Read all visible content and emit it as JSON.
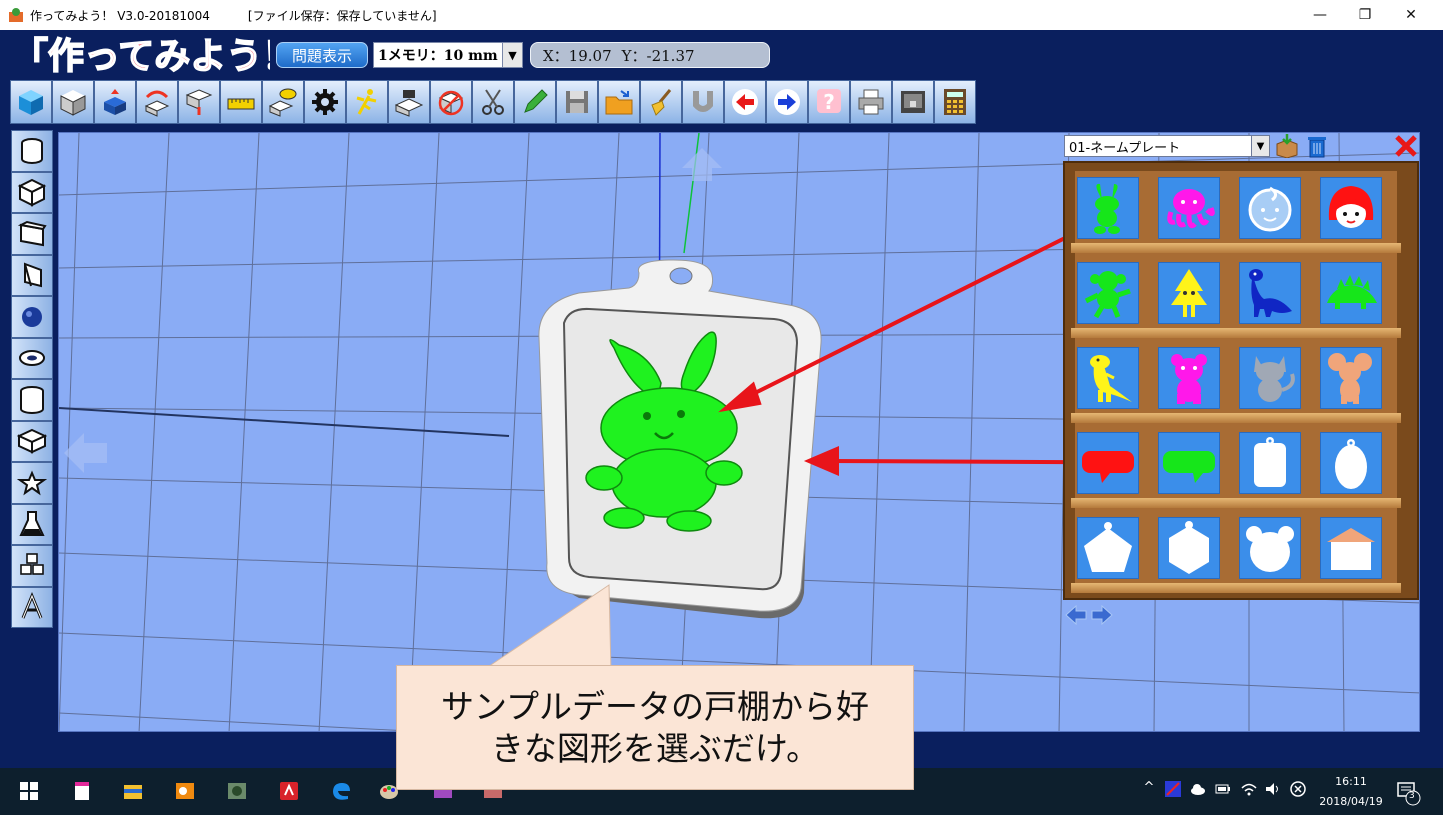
{
  "window": {
    "title": "作ってみよう！ V3.0-20181004",
    "file_status": "[ファイル保存：保存していません]",
    "minimize_glyph": "—",
    "maximize_glyph": "❐",
    "close_glyph": "✕"
  },
  "header": {
    "logo_text": "「作ってみよう！」",
    "problem_button": "問題表示",
    "memo_select_value": "1メモリ：10 mm",
    "coords": {
      "x": "X：19.07",
      "y": "Y：-21.37"
    }
  },
  "toolbar": {
    "tools": [
      "cube-icon",
      "box-icon",
      "move-icon",
      "rotate-icon",
      "drop-icon",
      "ruler-icon",
      "comment-icon",
      "gear-icon",
      "runner-icon",
      "stamp-icon",
      "no-box-icon",
      "scissors-icon",
      "pencil-icon",
      "save-icon",
      "open-folder-icon",
      "broom-icon",
      "magnet-icon",
      "undo-arrow-icon",
      "redo-arrow-icon",
      "help-icon",
      "print-icon",
      "printer3d-icon",
      "calculator-icon"
    ]
  },
  "left_tools": [
    "cylinder-icon",
    "cube-icon",
    "slanted-box-icon",
    "wedge-icon",
    "sphere-icon",
    "ring-icon",
    "tall-cylinder-icon",
    "chamfer-box-icon",
    "star-icon",
    "flask-icon",
    "cubes-icon",
    "letter-a-icon"
  ],
  "shelf": {
    "category": "01-ネームプレート",
    "close_glyph": "✕",
    "items": [
      {
        "name": "rabbit",
        "color": "#16e61a"
      },
      {
        "name": "octopus",
        "color": "#ff18ea"
      },
      {
        "name": "boy-face",
        "color": "#a8cdf5"
      },
      {
        "name": "red-hood",
        "color": "#ff1212"
      },
      {
        "name": "monkey",
        "color": "#16e61a"
      },
      {
        "name": "tree-creature",
        "color": "#fff41a"
      },
      {
        "name": "dinosaur",
        "color": "#1026c4"
      },
      {
        "name": "stegosaurus",
        "color": "#16e61a"
      },
      {
        "name": "t-rex",
        "color": "#fff41a"
      },
      {
        "name": "bear",
        "color": "#ff18ea"
      },
      {
        "name": "cat",
        "color": "#a0a8b5"
      },
      {
        "name": "mouse",
        "color": "#f0a57a"
      },
      {
        "name": "red-speech-bubble",
        "color": "#ff1212"
      },
      {
        "name": "green-speech-bubble",
        "color": "#16e61a"
      },
      {
        "name": "rect-tag",
        "color": "#ffffff"
      },
      {
        "name": "oval-tag",
        "color": "#ffffff"
      },
      {
        "name": "pentagon-tag",
        "color": "#ffffff"
      },
      {
        "name": "hexagon-tag",
        "color": "#ffffff"
      },
      {
        "name": "bear-face-tag",
        "color": "#ffffff"
      },
      {
        "name": "house-tag",
        "color": "#ffffff"
      }
    ]
  },
  "callout": {
    "line1": "サンプルデータの戸棚から好",
    "line2": "きな図形を選ぶだけ。"
  },
  "taskbar": {
    "time": "16:11",
    "date": "2018/04/19",
    "notification_count": "3",
    "apps": [
      "windows-start-icon",
      "notepad-icon",
      "file-explorer-icon",
      "outlook-icon",
      "gaming-app-icon",
      "acrobat-icon",
      "edge-icon",
      "paint-icon",
      "image-app-icon",
      "photo-app-icon"
    ]
  },
  "colors": {
    "app_background": "#0a1f5e",
    "viewport": "#8aacf5",
    "callout": "#fbe5d6",
    "arrow": "#e8141a",
    "model_green": "#1ff21f"
  }
}
